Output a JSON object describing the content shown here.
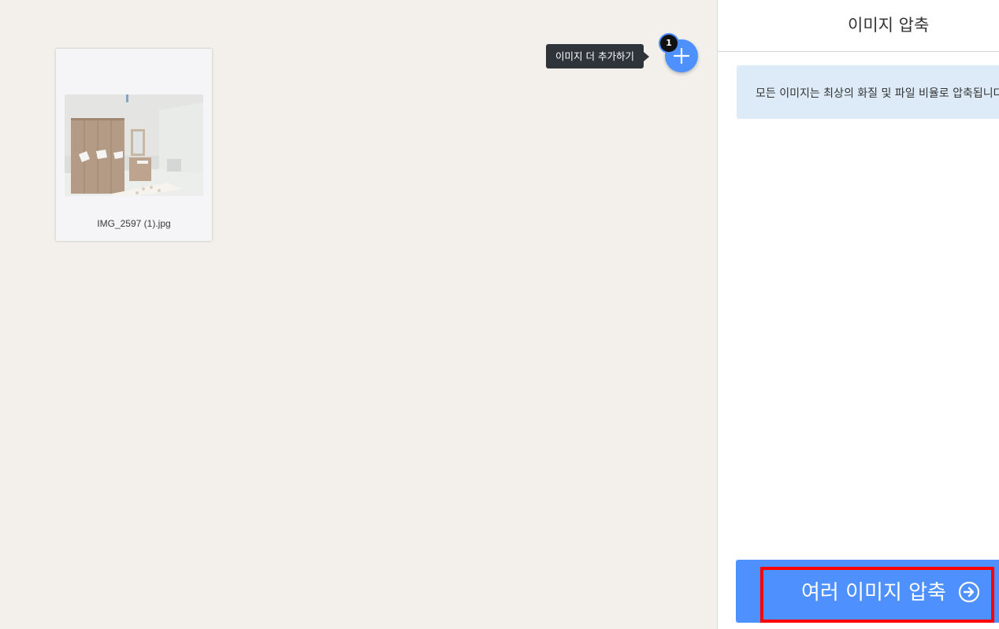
{
  "workspace": {
    "file": {
      "name": "IMG_2597 (1).jpg",
      "thumbnail_icon": "room-photo-thumbnail"
    },
    "add_more": {
      "tooltip": "이미지 더 추가하기",
      "icon": "plus-icon",
      "count": "1"
    }
  },
  "sidebar": {
    "title": "이미지 압축",
    "info": "모든 이미지는 최상의 화질 및 파일 비율로 압축됩니다.",
    "compress_button": {
      "label": "여러 이미지 압축",
      "icon": "arrow-right-circle-icon"
    }
  },
  "colors": {
    "workspace_bg": "#f3f0ec",
    "accent": "#4d90fe",
    "info_bg": "#dcebf7",
    "tooltip_bg": "#2e343a",
    "highlight": "#ff0000"
  }
}
